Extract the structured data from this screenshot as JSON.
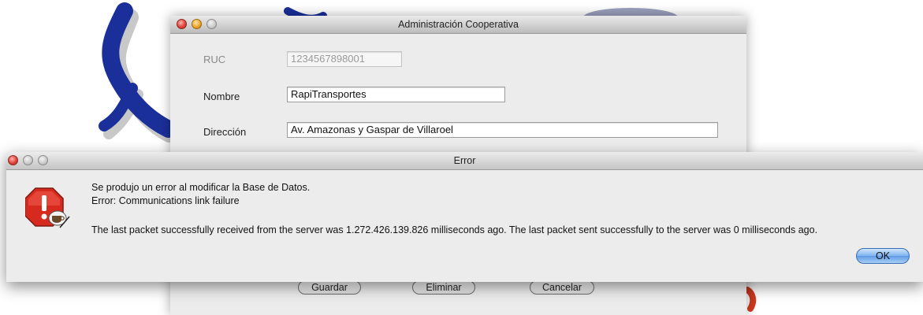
{
  "back_window": {
    "title": "Administración Cooperativa",
    "ruc_label": "RUC",
    "ruc_value": "1234567898001",
    "nombre_label": "Nombre",
    "nombre_value": "RapiTransportes",
    "direccion_label": "Dirección",
    "direccion_value": "Av. Amazonas y Gaspar de Villaroel",
    "buttons": {
      "guardar": "Guardar",
      "eliminar": "Eliminar",
      "cancelar": "Cancelar"
    }
  },
  "error_dialog": {
    "title": "Error",
    "icon": "stop-caution-icon",
    "line1": "Se produjo un error al modificar la Base de Datos.",
    "line2": "Error: Communications link failure",
    "line3": "The last packet successfully received from the server was 1.272.426.139.826 milliseconds ago.  The last packet sent successfully to the server was 0 milliseconds ago.",
    "ok_label": "OK"
  },
  "colors": {
    "logo_blue": "#1b2f9a",
    "stop_red": "#d62a1e",
    "ok_blue": "#7fb2ee"
  }
}
